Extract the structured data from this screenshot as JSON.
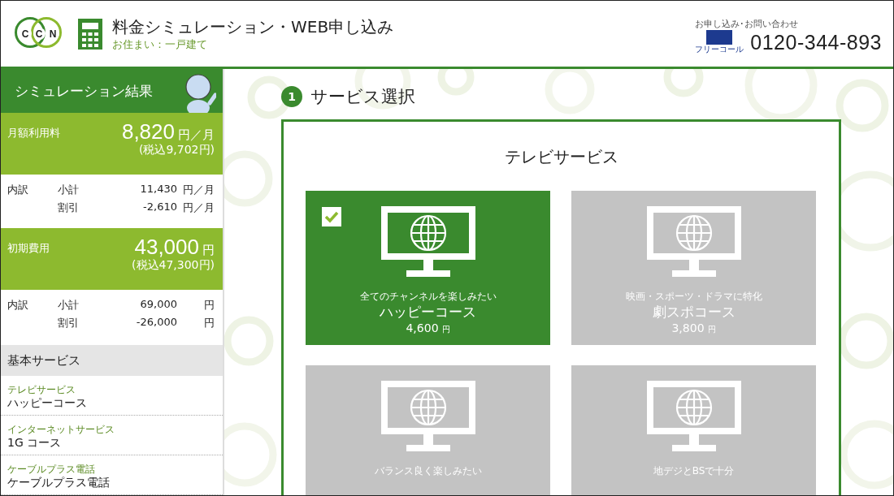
{
  "header": {
    "logo_letters": [
      "C",
      "C",
      "N"
    ],
    "title": "料金シミュレーション・WEB申し込み",
    "subtitle": "お住まい：一戸建て",
    "contact_label": "お申し込み･お問い合わせ",
    "freecall_label": "フリーコール",
    "phone": "0120-344-893"
  },
  "sidebar": {
    "title": "シミュレーション結果",
    "totals": [
      {
        "label": "月額利用料",
        "amount": "8,820",
        "unit": "円／月",
        "tax": "(税込9,702円)",
        "breakdown_label": "内訳",
        "rows": [
          {
            "name": "小計",
            "value": "11,430",
            "unit": "円／月"
          },
          {
            "name": "割引",
            "value": "-2,610",
            "unit": "円／月"
          }
        ]
      },
      {
        "label": "初期費用",
        "amount": "43,000",
        "unit": "円",
        "tax": "(税込47,300円)",
        "breakdown_label": "内訳",
        "rows": [
          {
            "name": "小計",
            "value": "69,000",
            "unit": "円"
          },
          {
            "name": "割引",
            "value": "-26,000",
            "unit": "円"
          }
        ]
      }
    ],
    "basic_services": {
      "heading": "基本サービス",
      "items": [
        {
          "category": "テレビサービス",
          "value": "ハッピーコース"
        },
        {
          "category": "インターネットサービス",
          "value": "1G コース"
        },
        {
          "category": "ケーブルプラス電話",
          "value": "ケーブルプラス電話"
        }
      ]
    }
  },
  "main": {
    "step": {
      "number": "1",
      "title": "サービス選択"
    },
    "section": {
      "title": "テレビサービス",
      "cards": [
        {
          "tagline": "全てのチャンネルを楽しみたい",
          "name": "ハッピーコース",
          "price": "4,600",
          "unit": "円",
          "selected": true
        },
        {
          "tagline": "映画・スポーツ・ドラマに特化",
          "name": "劇スポコース",
          "price": "3,800",
          "unit": "円",
          "selected": false
        },
        {
          "tagline": "バランス良く楽しみたい",
          "selected": false
        },
        {
          "tagline": "地デジとBSで十分",
          "selected": false
        }
      ]
    }
  }
}
